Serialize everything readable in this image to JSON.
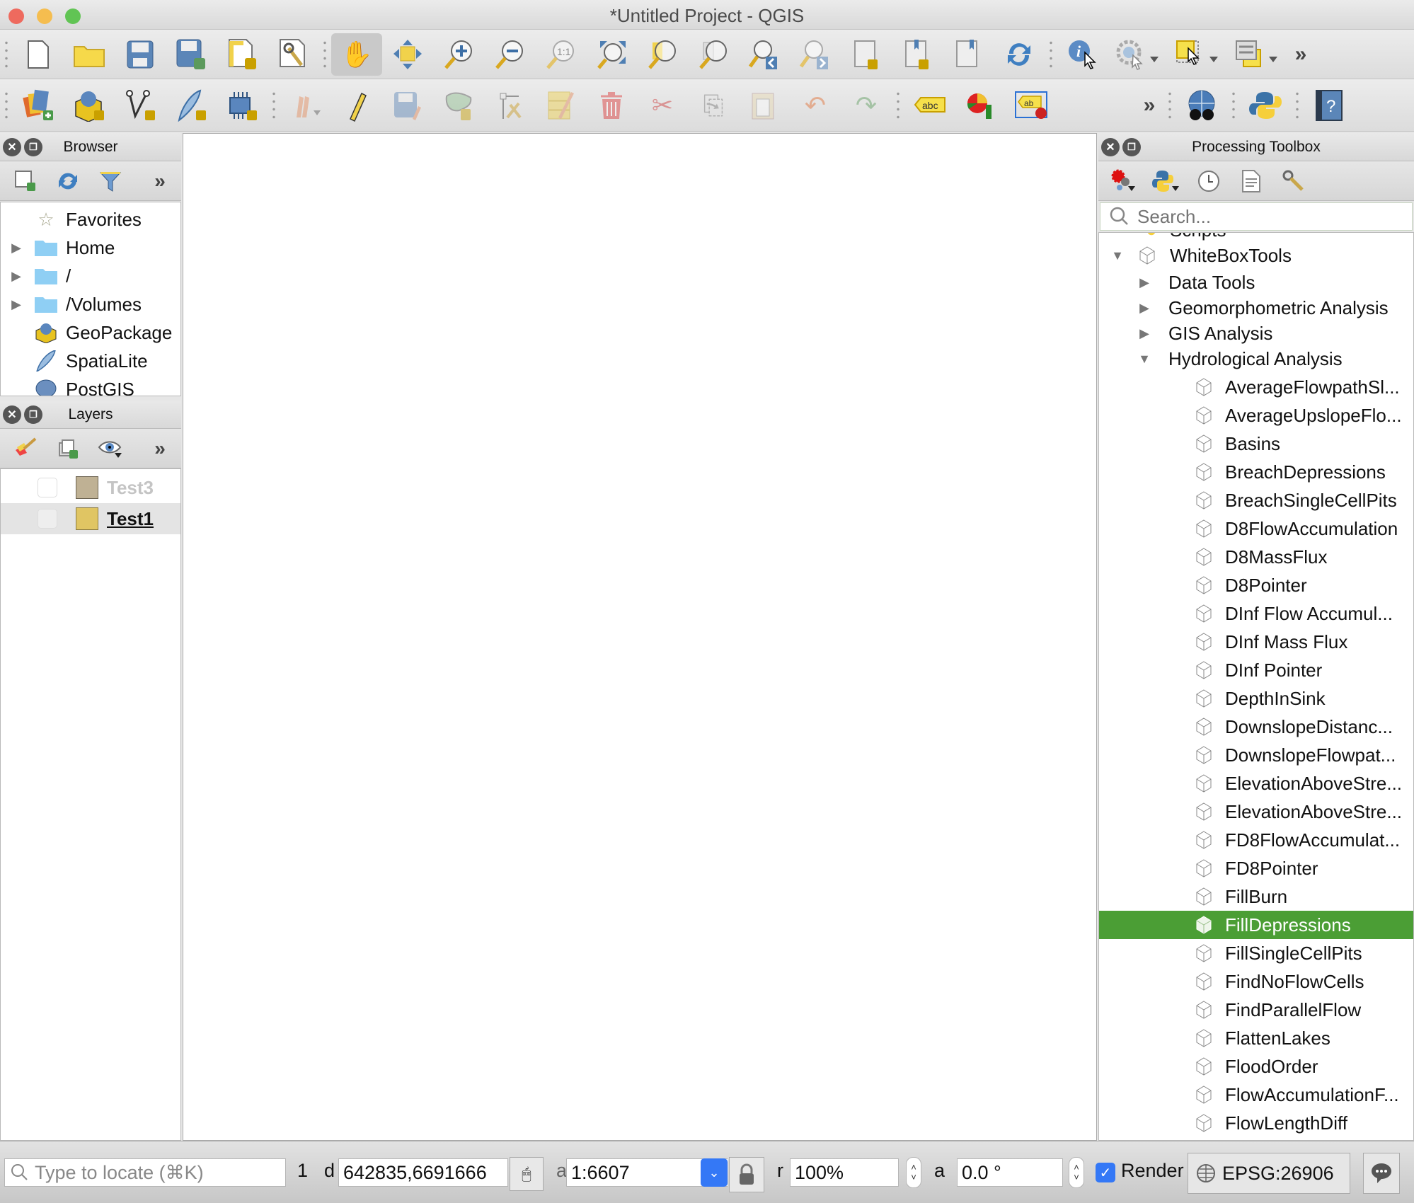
{
  "window": {
    "title": "*Untitled Project - QGIS",
    "traffic_lights": {
      "close": "#ee6a5e",
      "minimize": "#f5bd4f",
      "zoom": "#61c454"
    }
  },
  "toolbar_row1": [
    {
      "name": "new-project",
      "icon": "🗋"
    },
    {
      "name": "open-project",
      "icon": "📂"
    },
    {
      "name": "save-project",
      "icon": "💾"
    },
    {
      "name": "save-project-as",
      "icon": "💾"
    },
    {
      "name": "new-print-layout",
      "icon": "📐"
    },
    {
      "name": "layout-manager",
      "icon": "🔧"
    },
    {
      "name": "pan-map",
      "icon": "✋",
      "active": true
    },
    {
      "name": "pan-to-selection",
      "icon": "✥"
    },
    {
      "name": "zoom-in",
      "icon": "🔍"
    },
    {
      "name": "zoom-out",
      "icon": "🔍"
    },
    {
      "name": "zoom-native-resolution",
      "icon": "🔍"
    },
    {
      "name": "zoom-full",
      "icon": "⤧"
    },
    {
      "name": "zoom-to-selection",
      "icon": "🔍"
    },
    {
      "name": "zoom-to-layer",
      "icon": "🔍"
    },
    {
      "name": "zoom-last",
      "icon": "🔍"
    },
    {
      "name": "zoom-next",
      "icon": "🔍"
    },
    {
      "name": "new-map-view",
      "icon": "📜"
    },
    {
      "name": "new-bookmark",
      "icon": "🔖"
    },
    {
      "name": "show-bookmarks",
      "icon": "🔖"
    },
    {
      "name": "refresh",
      "icon": "🔄"
    },
    {
      "name": "identify-features",
      "icon": "ℹ"
    },
    {
      "name": "run-feature-action",
      "icon": "⚙"
    },
    {
      "name": "select-features",
      "icon": "⬚"
    },
    {
      "name": "attribute-table",
      "icon": "▤"
    }
  ],
  "toolbar_row2": [
    {
      "name": "data-source-manager",
      "icon": "🗂"
    },
    {
      "name": "new-geopackage-layer",
      "icon": "📦"
    },
    {
      "name": "new-shapefile-layer",
      "icon": "V"
    },
    {
      "name": "new-spatialite-layer",
      "icon": "🪶"
    },
    {
      "name": "new-virtual-layer",
      "icon": "▦"
    },
    {
      "name": "current-edits",
      "icon": "✏",
      "disabled": true
    },
    {
      "name": "toggle-editing",
      "icon": "✏"
    },
    {
      "name": "save-layer-edits",
      "icon": "💾",
      "disabled": true
    },
    {
      "name": "add-feature",
      "icon": "⬭",
      "disabled": true
    },
    {
      "name": "vertex-tool",
      "icon": "✂",
      "disabled": true
    },
    {
      "name": "modify-attributes",
      "icon": "✎",
      "disabled": true
    },
    {
      "name": "delete-selected",
      "icon": "🗑",
      "disabled": true
    },
    {
      "name": "cut-features",
      "icon": "✂",
      "disabled": true
    },
    {
      "name": "copy-features",
      "icon": "⎘",
      "disabled": true
    },
    {
      "name": "paste-features",
      "icon": "📋",
      "disabled": true
    },
    {
      "name": "undo",
      "icon": "↶",
      "disabled": true
    },
    {
      "name": "redo",
      "icon": "↷",
      "disabled": true
    },
    {
      "name": "layer-labeling",
      "icon": "abc"
    },
    {
      "name": "layer-diagram",
      "icon": "◕"
    },
    {
      "name": "highlight-pinned-labels",
      "icon": "ab"
    },
    {
      "name": "metasearch",
      "icon": "🌐"
    },
    {
      "name": "python-console",
      "icon": "🐍"
    },
    {
      "name": "help",
      "icon": "?"
    }
  ],
  "browser": {
    "title": "Browser",
    "items": [
      {
        "label": "Favorites",
        "icon": "☆",
        "expandable": false
      },
      {
        "label": "Home",
        "icon": "folder",
        "expandable": true
      },
      {
        "label": "/",
        "icon": "folder",
        "expandable": true
      },
      {
        "label": "/Volumes",
        "icon": "folder",
        "expandable": true
      },
      {
        "label": "GeoPackage",
        "icon": "📦",
        "expandable": false
      },
      {
        "label": "SpatiaLite",
        "icon": "🪶",
        "expandable": false
      },
      {
        "label": "PostGIS",
        "icon": "🐘",
        "expandable": false
      }
    ]
  },
  "layers": {
    "title": "Layers",
    "items": [
      {
        "label": "Test3",
        "color": "#bfb194",
        "checked": false,
        "active": false
      },
      {
        "label": "Test1",
        "color": "#e0c563",
        "checked": false,
        "active": true
      }
    ]
  },
  "toolbox": {
    "title": "Processing Toolbox",
    "search_placeholder": "Search...",
    "partial_top": "Scripts",
    "provider": "WhiteBoxTools",
    "groups": [
      {
        "label": "Data Tools",
        "expanded": false
      },
      {
        "label": "Geomorphometric Analysis",
        "expanded": false
      },
      {
        "label": "GIS Analysis",
        "expanded": false
      },
      {
        "label": "Hydrological Analysis",
        "expanded": true
      }
    ],
    "tools": [
      "AverageFlowpathSl...",
      "AverageUpslopeFlo...",
      "Basins",
      "BreachDepressions",
      "BreachSingleCellPits",
      "D8FlowAccumulation",
      "D8MassFlux",
      "D8Pointer",
      "DInf Flow Accumul...",
      "DInf Mass Flux",
      "DInf Pointer",
      "DepthInSink",
      "DownslopeDistanc...",
      "DownslopeFlowpat...",
      "ElevationAboveStre...",
      "ElevationAboveStre...",
      "FD8FlowAccumulat...",
      "FD8Pointer",
      "FillBurn",
      "FillDepressions",
      "FillSingleCellPits",
      "FindNoFlowCells",
      "FindParallelFlow",
      "FlattenLakes",
      "FloodOrder",
      "FlowAccumulationF...",
      "FlowLengthDiff"
    ],
    "selected_tool": "FillDepressions",
    "selection_color": "#4b9e35"
  },
  "statusbar": {
    "locator_placeholder": "Type to locate (⌘K)",
    "coord_label_cut": "1",
    "coord_label2_cut": "d",
    "coordinate": "642835,6691666",
    "scale_label_cut": "a",
    "scale": "1:6607",
    "magnifier_label_cut": "r",
    "magnifier": "100%",
    "rotation_label_cut": "a",
    "rotation": "0.0 °",
    "render_label": "Render",
    "render_checked": true,
    "crs": "EPSG:26906"
  }
}
